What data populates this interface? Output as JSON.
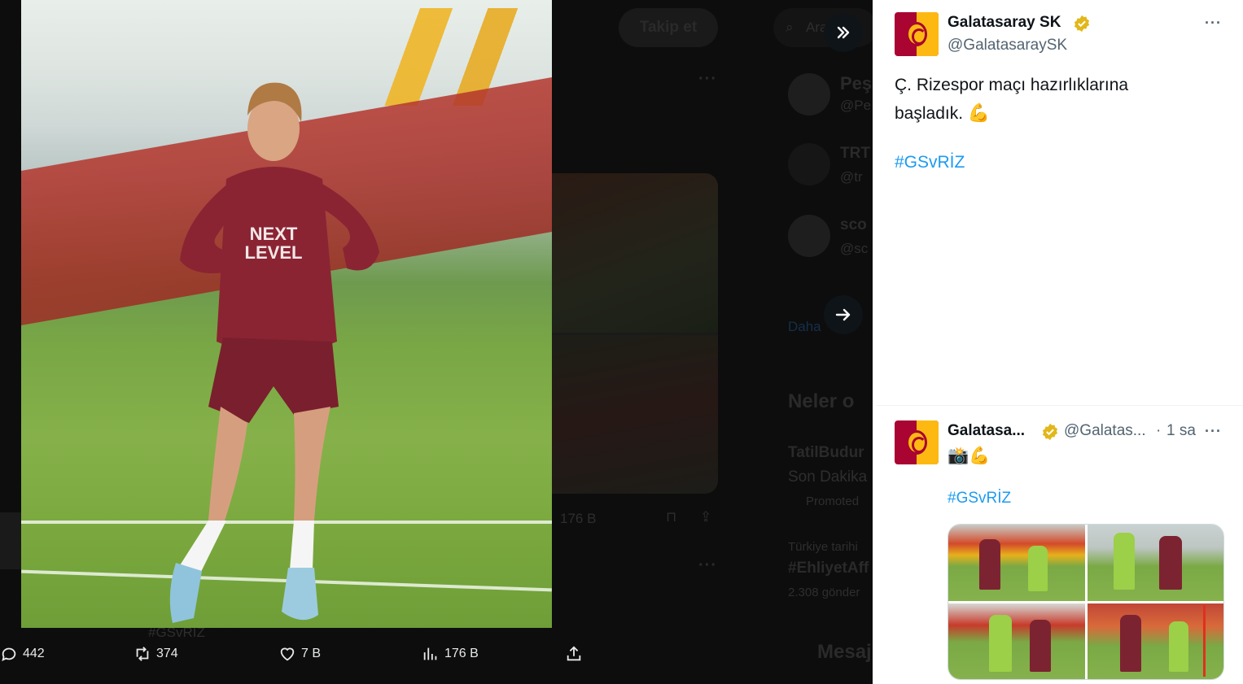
{
  "background": {
    "follow_label": "Takip et",
    "search_placeholder": "Ara",
    "who_to_follow": [
      {
        "name": "Peşi",
        "handle": "@Pe"
      },
      {
        "name": "TRT",
        "handle": "@tr"
      },
      {
        "name": "sco",
        "handle": "@sc"
      }
    ],
    "show_more": "Daha",
    "trends_heading": "Neler o",
    "trends": [
      {
        "title": "TatilBudur",
        "subtitle": "Son Dakika",
        "meta": "Promoted"
      },
      {
        "context": "Türkiye tarihi",
        "title": "#EhliyetAff",
        "meta": "2.308 gönder"
      }
    ],
    "messages_label": "Mesaj",
    "faded_views": "176 B",
    "faded_hashtag": "#GSvRİZ"
  },
  "actions": {
    "replies": "442",
    "retweets": "374",
    "likes": "7 B",
    "views": "176 B"
  },
  "main_tweet": {
    "name": "Galatasaray SK",
    "handle": "@GalatasaraySK",
    "text_line1": "Ç. Rizespor maçı hazırlıklarına",
    "text_line2": "başladık.",
    "emoji": "💪",
    "hashtag": "#GSvRİZ"
  },
  "reply_tweet": {
    "name": "Galatasa...",
    "handle": "@Galatas...",
    "separator": "·",
    "time": "1 sa",
    "emojis": "📸💪",
    "hashtag": "#GSvRİZ"
  },
  "colors": {
    "accent": "#1d9bf0",
    "brand_red": "#a90432",
    "brand_yellow": "#fdb912",
    "verified_gold": "#e2b719"
  }
}
